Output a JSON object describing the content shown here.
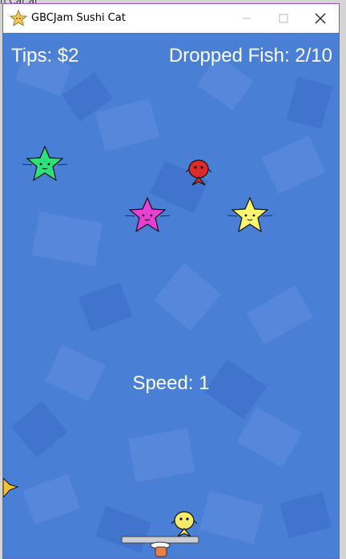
{
  "background_text": "n Cat.at",
  "window": {
    "title": "GBCJam Sushi Cat",
    "icon": "star-cat-icon",
    "controls": [
      "minimize-icon",
      "maximize-icon",
      "close-icon"
    ]
  },
  "hud": {
    "tips": "Tips: $2",
    "dropped_fish": "Dropped Fish: 2/10",
    "speed": "Speed: 1"
  },
  "colors": {
    "background": "#4a7fd6",
    "hud_text": "#ffffff",
    "star_green": "#2ee07a",
    "star_magenta": "#e93fd4",
    "star_yellow": "#fbf56e",
    "fish_red": "#e02a2a",
    "fish_yellow": "#f5ea6a",
    "edge_star": "#f6c233",
    "tray": "#c9cdd6"
  },
  "sprites": [
    "star-cat-green",
    "star-cat-magenta",
    "star-cat-yellow",
    "red-fish-cat",
    "edge-star-partial",
    "yellow-fish-cat-player",
    "serving-tray"
  ]
}
